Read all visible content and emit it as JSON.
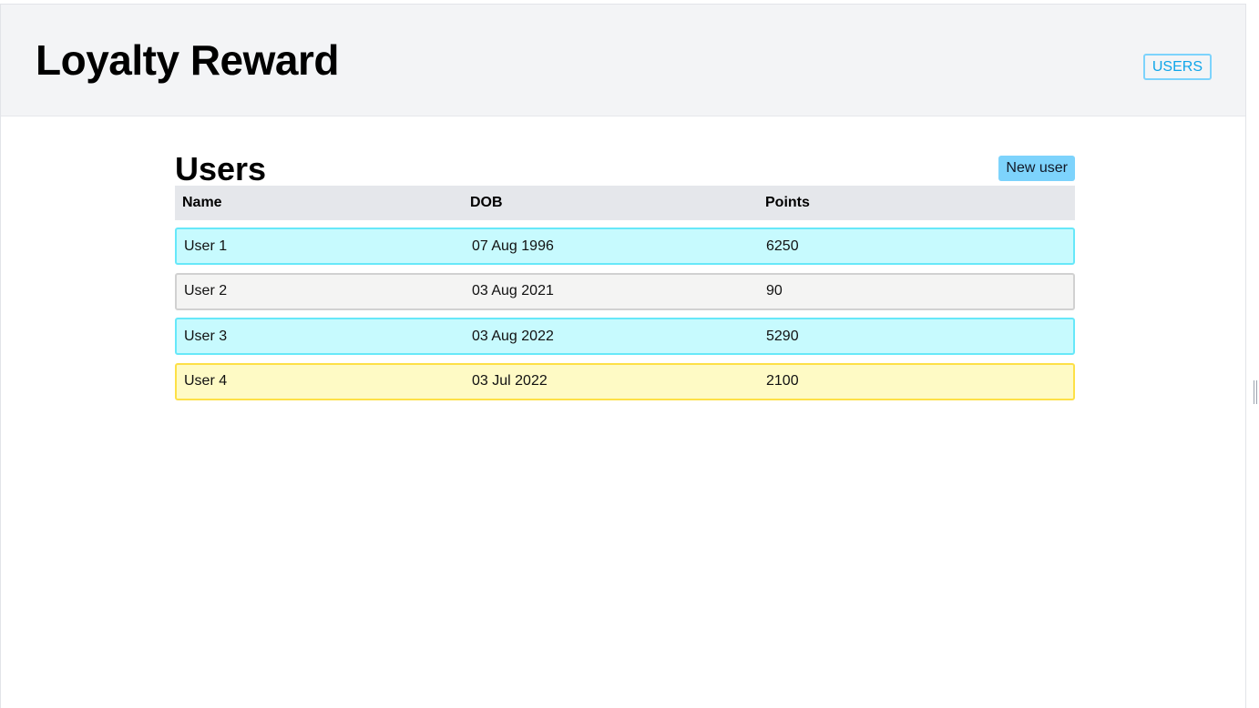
{
  "header": {
    "app_title": "Loyalty Reward",
    "nav_users_label": "USERS"
  },
  "main": {
    "page_title": "Users",
    "new_user_label": "New user",
    "columns": [
      "Name",
      "DOB",
      "Points"
    ],
    "rows": [
      {
        "name": "User 1",
        "dob": "07 Aug 1996",
        "points": "6250",
        "tier_color": "#c7fafe"
      },
      {
        "name": "User 2",
        "dob": "03 Aug 2021",
        "points": "90",
        "tier_color": "#f4f4f3"
      },
      {
        "name": "User 3",
        "dob": "03 Aug 2022",
        "points": "5290",
        "tier_color": "#c7fafe"
      },
      {
        "name": "User 4",
        "dob": "03 Jul 2022",
        "points": "2100",
        "tier_color": "#fefac5"
      }
    ]
  },
  "colors": {
    "header_bg": "#f3f4f6",
    "accent": "#7dd3fc",
    "accent_text": "#0ea5e9",
    "table_head_bg": "#e5e7eb"
  }
}
